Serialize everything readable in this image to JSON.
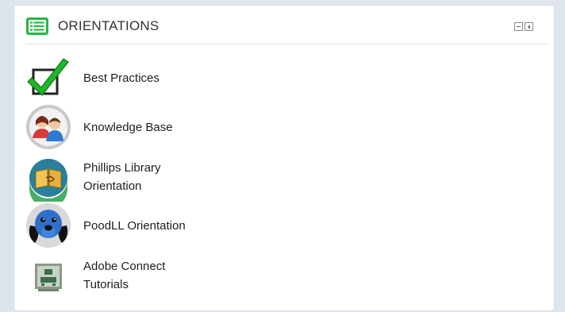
{
  "block": {
    "title": "ORIENTATIONS"
  },
  "items": [
    {
      "icon": "checkmark-icon",
      "label": "Best Practices"
    },
    {
      "icon": "people-icon",
      "label": "Knowledge Base"
    },
    {
      "icon": "library-book-icon",
      "label_line1": "Phillips Library",
      "label_line2": "Orientation"
    },
    {
      "icon": "dog-icon",
      "label": "PoodLL Orientation"
    },
    {
      "icon": "adobe-connect-icon",
      "label_line1": "Adobe Connect",
      "label_line2": "Tutorials"
    }
  ],
  "colors": {
    "header_icon": "#2db34a",
    "check": "#1fb528",
    "library_bg": "#2a7f9a"
  }
}
